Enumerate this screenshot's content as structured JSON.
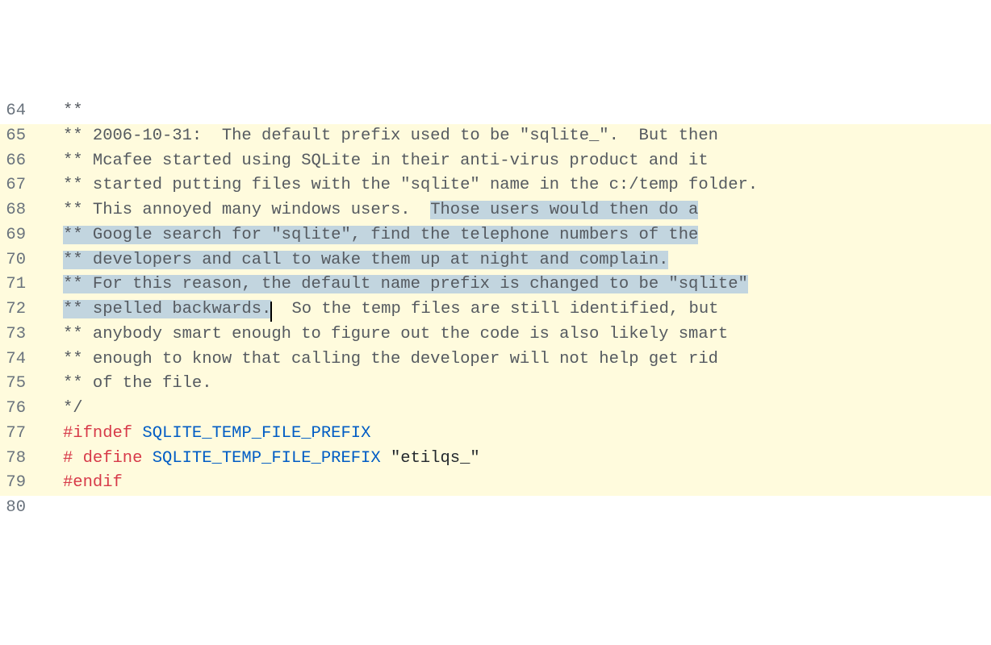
{
  "lines": [
    {
      "num": "64",
      "hl": false,
      "segs": [
        {
          "cls": "comment",
          "text": "**"
        }
      ]
    },
    {
      "num": "65",
      "hl": true,
      "segs": [
        {
          "cls": "comment",
          "text": "** 2006-10-31:  The default prefix used to be \"sqlite_\".  But then"
        }
      ]
    },
    {
      "num": "66",
      "hl": true,
      "segs": [
        {
          "cls": "comment",
          "text": "** Mcafee started using SQLite in their anti-virus product and it"
        }
      ]
    },
    {
      "num": "67",
      "hl": true,
      "segs": [
        {
          "cls": "comment",
          "text": "** started putting files with the \"sqlite\" name in the c:/temp folder."
        }
      ]
    },
    {
      "num": "68",
      "hl": true,
      "segs": [
        {
          "cls": "comment",
          "text": "** This annoyed many windows users.  "
        },
        {
          "cls": "comment sel",
          "text": "Those users would then do a"
        }
      ]
    },
    {
      "num": "69",
      "hl": true,
      "segs": [
        {
          "cls": "comment sel",
          "text": "** Google search for \"sqlite\", find the telephone numbers of the"
        }
      ]
    },
    {
      "num": "70",
      "hl": true,
      "segs": [
        {
          "cls": "comment sel",
          "text": "** developers and call to wake them up at night and complain."
        }
      ]
    },
    {
      "num": "71",
      "hl": true,
      "segs": [
        {
          "cls": "comment sel",
          "text": "** For this reason, the default name prefix is changed to be \"sqlite\""
        }
      ]
    },
    {
      "num": "72",
      "hl": true,
      "segs": [
        {
          "cls": "comment sel",
          "text": "** spelled backwards."
        },
        {
          "cls": "cursor",
          "text": ""
        },
        {
          "cls": "comment",
          "text": "  So the temp files are still identified, but"
        }
      ]
    },
    {
      "num": "73",
      "hl": true,
      "segs": [
        {
          "cls": "comment",
          "text": "** anybody smart enough to figure out the code is also likely smart"
        }
      ]
    },
    {
      "num": "74",
      "hl": true,
      "segs": [
        {
          "cls": "comment",
          "text": "** enough to know that calling the developer will not help get rid"
        }
      ]
    },
    {
      "num": "75",
      "hl": true,
      "segs": [
        {
          "cls": "comment",
          "text": "** of the file."
        }
      ]
    },
    {
      "num": "76",
      "hl": true,
      "segs": [
        {
          "cls": "comment",
          "text": "*/"
        }
      ]
    },
    {
      "num": "77",
      "hl": true,
      "segs": [
        {
          "cls": "directive",
          "text": "#ifndef "
        },
        {
          "cls": "macro",
          "text": "SQLITE_TEMP_FILE_PREFIX"
        }
      ]
    },
    {
      "num": "78",
      "hl": true,
      "segs": [
        {
          "cls": "directive",
          "text": "# define "
        },
        {
          "cls": "macro",
          "text": "SQLITE_TEMP_FILE_PREFIX "
        },
        {
          "cls": "str",
          "text": "\"etilqs_\""
        }
      ]
    },
    {
      "num": "79",
      "hl": true,
      "segs": [
        {
          "cls": "directive",
          "text": "#endif"
        }
      ]
    },
    {
      "num": "80",
      "hl": false,
      "segs": [
        {
          "cls": "",
          "text": " "
        }
      ]
    }
  ]
}
